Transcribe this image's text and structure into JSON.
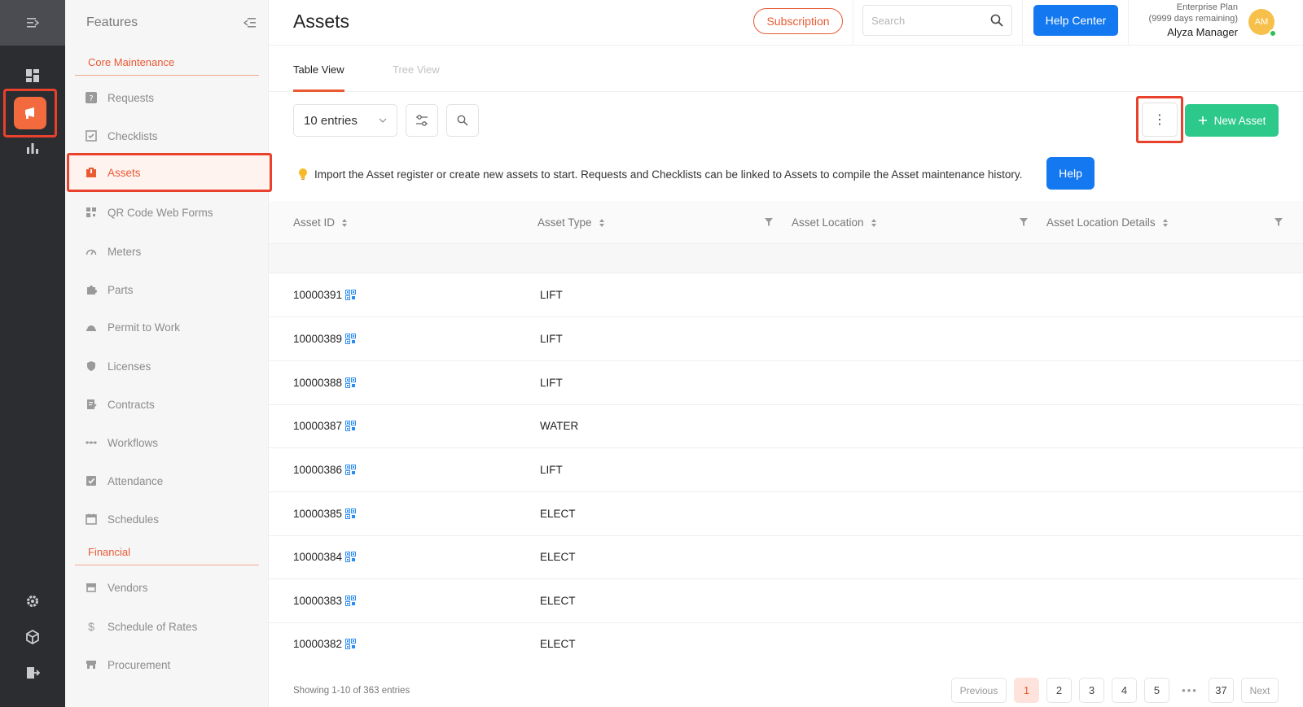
{
  "features": {
    "title": "Features",
    "sections": [
      {
        "title": "Core Maintenance",
        "items": [
          {
            "label": "Requests",
            "icon": "question-icon"
          },
          {
            "label": "Checklists",
            "icon": "checklist-icon"
          },
          {
            "label": "Assets",
            "icon": "asset-icon",
            "active": true
          },
          {
            "label": "QR Code Web Forms",
            "icon": "qr-icon"
          },
          {
            "label": "Meters",
            "icon": "meter-icon"
          },
          {
            "label": "Parts",
            "icon": "puzzle-icon"
          },
          {
            "label": "Permit to Work",
            "icon": "permit-icon"
          },
          {
            "label": "Licenses",
            "icon": "shield-icon"
          },
          {
            "label": "Contracts",
            "icon": "contract-icon"
          },
          {
            "label": "Workflows",
            "icon": "workflow-icon"
          },
          {
            "label": "Attendance",
            "icon": "check-box-icon"
          },
          {
            "label": "Schedules",
            "icon": "calendar-icon"
          }
        ]
      },
      {
        "title": "Financial",
        "items": [
          {
            "label": "Vendors",
            "icon": "store-icon"
          },
          {
            "label": "Schedule of Rates",
            "icon": "dollar-icon"
          },
          {
            "label": "Procurement",
            "icon": "procurement-icon"
          }
        ]
      }
    ]
  },
  "header": {
    "title": "Assets",
    "subscription": "Subscription",
    "search_placeholder": "Search",
    "help_center": "Help Center",
    "plan_name": "Enterprise Plan",
    "plan_remaining": "(9999 days remaining)",
    "user_name": "Alyza Manager",
    "avatar_initials": "AM"
  },
  "tabs": [
    {
      "label": "Table View",
      "active": true
    },
    {
      "label": "Tree View",
      "active": false
    }
  ],
  "toolbar": {
    "entries": "10 entries",
    "more": "⋮",
    "new_asset": "New Asset"
  },
  "info": {
    "text": "Import the Asset register or create new assets to start. Requests and Checklists can be linked to Assets to compile the Asset maintenance history.",
    "help": "Help"
  },
  "table": {
    "columns": [
      "Asset ID",
      "Asset Type",
      "Asset Location",
      "Asset Location Details"
    ],
    "rows": [
      {
        "id": "10000391",
        "type": "LIFT"
      },
      {
        "id": "10000389",
        "type": "LIFT"
      },
      {
        "id": "10000388",
        "type": "LIFT"
      },
      {
        "id": "10000387",
        "type": "WATER"
      },
      {
        "id": "10000386",
        "type": "LIFT"
      },
      {
        "id": "10000385",
        "type": "ELECT"
      },
      {
        "id": "10000384",
        "type": "ELECT"
      },
      {
        "id": "10000383",
        "type": "ELECT"
      },
      {
        "id": "10000382",
        "type": "ELECT"
      }
    ]
  },
  "footer": {
    "showing": "Showing 1-10 of 363 entries",
    "previous": "Previous",
    "pages": [
      "1",
      "2",
      "3",
      "4",
      "5"
    ],
    "dots": "•••",
    "last": "37",
    "next": "Next",
    "current": "1"
  },
  "colors": {
    "accent": "#ea5a33",
    "primary_blue": "#1478f0",
    "success_green": "#2dc98a",
    "highlight_red": "#e8412c"
  }
}
